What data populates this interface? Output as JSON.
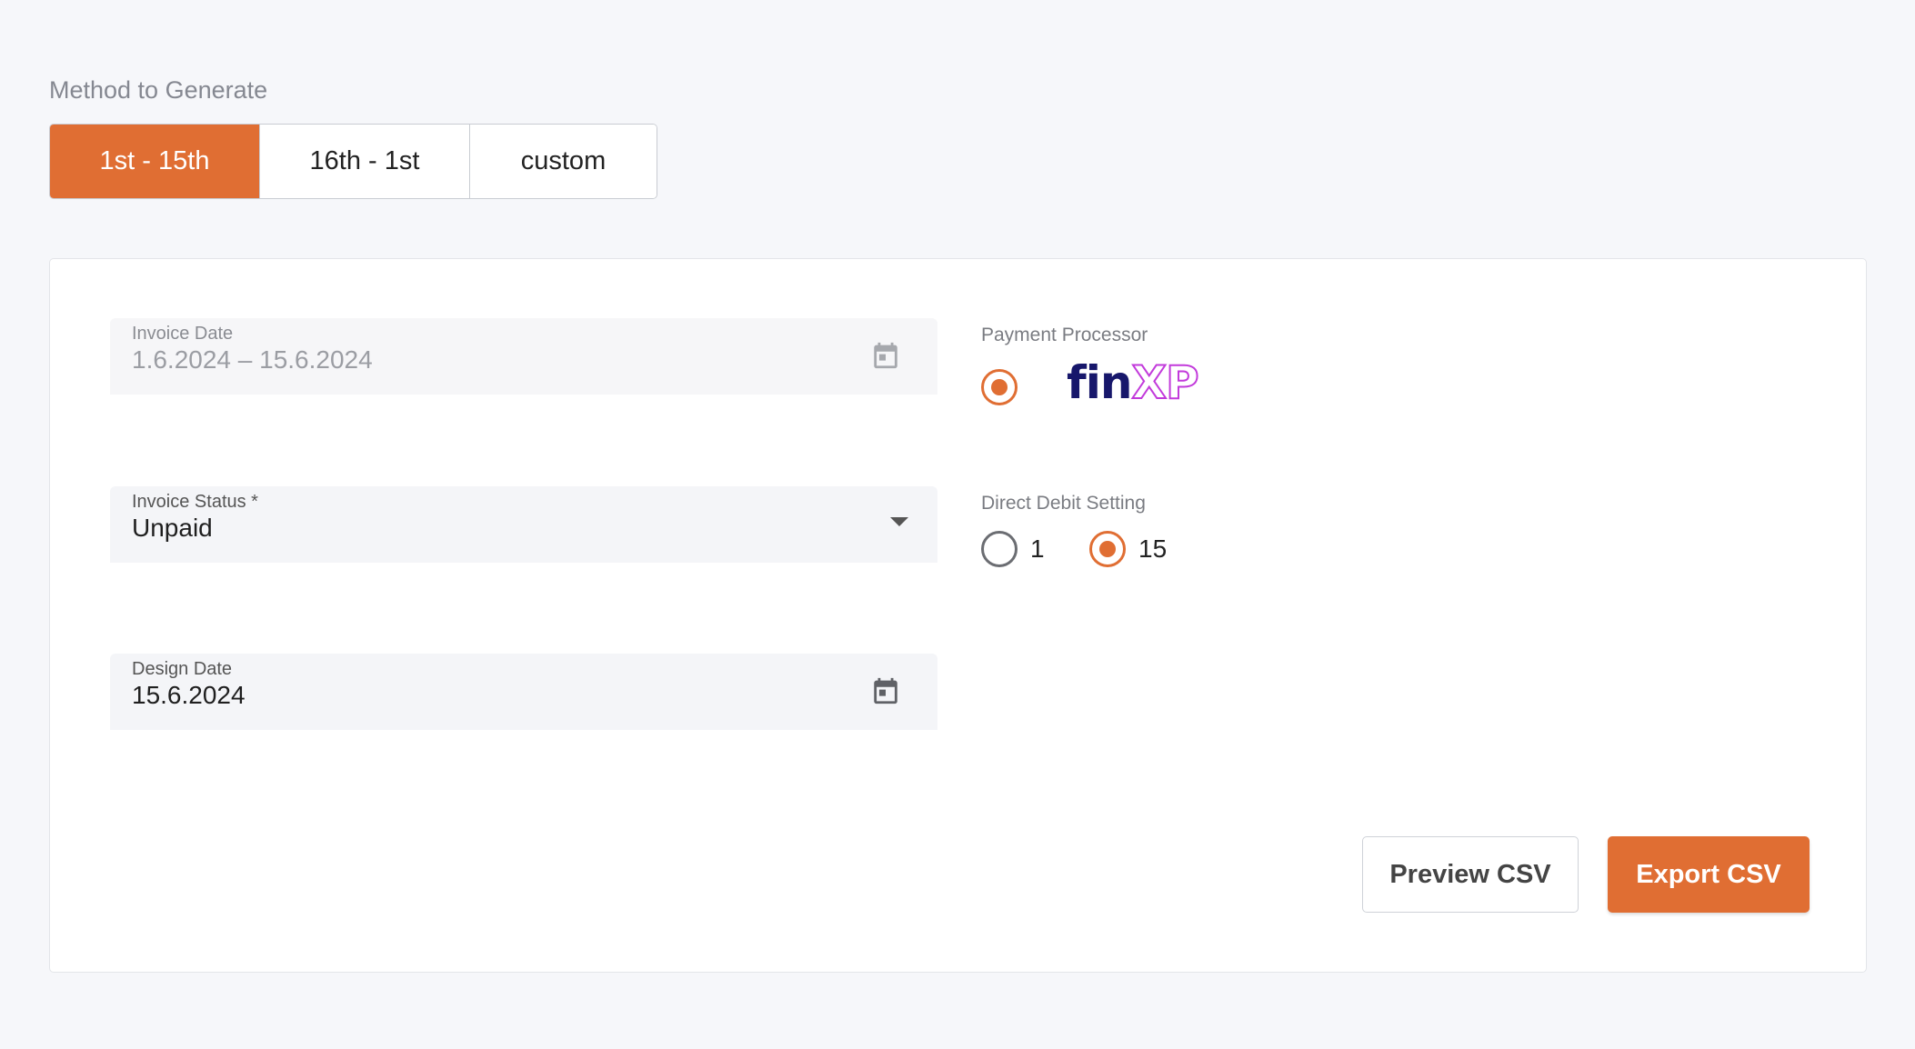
{
  "method": {
    "label": "Method to Generate",
    "options": [
      "1st - 15th",
      "16th - 1st",
      "custom"
    ],
    "selected": "1st - 15th"
  },
  "invoice_date": {
    "label": "Invoice Date",
    "value": "1.6.2024 – 15.6.2024",
    "icon": "calendar-icon"
  },
  "invoice_status": {
    "label": "Invoice Status *",
    "value": "Unpaid",
    "icon": "dropdown-caret-icon"
  },
  "design_date": {
    "label": "Design Date",
    "value": "15.6.2024",
    "icon": "calendar-icon"
  },
  "payment_processor": {
    "label": "Payment Processor",
    "logo": {
      "part1": "fin",
      "part2": "XP"
    },
    "selected": true
  },
  "direct_debit": {
    "label": "Direct Debit Setting",
    "options": [
      "1",
      "15"
    ],
    "selected": "15"
  },
  "actions": {
    "preview": "Preview CSV",
    "export": "Export CSV"
  },
  "colors": {
    "accent": "#e06e33",
    "logo_dark": "#17176b",
    "logo_magenta": "#c23adb"
  }
}
